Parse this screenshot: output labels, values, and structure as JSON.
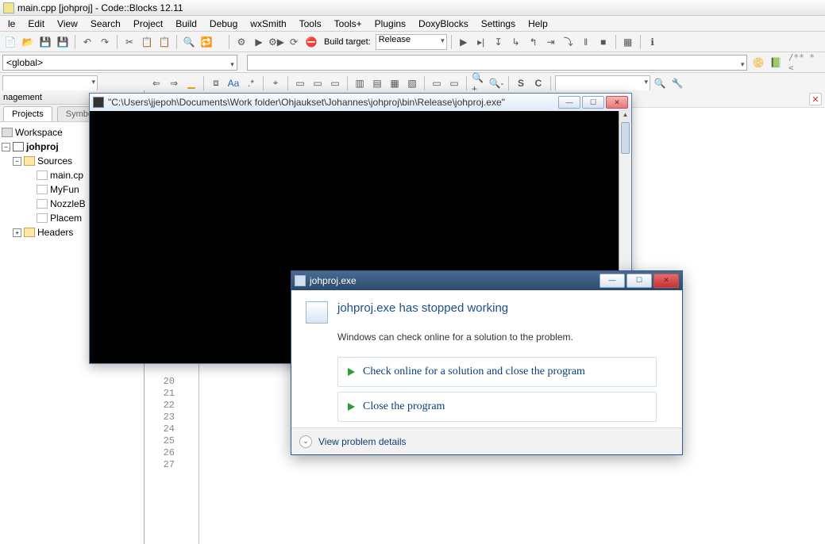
{
  "window_title": "main.cpp [johproj] - Code::Blocks 12.11",
  "menus": [
    "le",
    "Edit",
    "View",
    "Search",
    "Project",
    "Build",
    "Debug",
    "wxSmith",
    "Tools",
    "Tools+",
    "Plugins",
    "DoxyBlocks",
    "Settings",
    "Help"
  ],
  "build_target_label": "Build target:",
  "build_target_value": "Release",
  "global_scope": "<global>",
  "management_label": "nagement",
  "tabs": {
    "projects": "Projects",
    "symbols": "Symbol"
  },
  "tree": {
    "workspace": "Workspace",
    "project": "johproj",
    "sources": "Sources",
    "files": [
      "main.cp",
      "MyFun",
      "NozzleB",
      "Placem"
    ],
    "headers": "Headers"
  },
  "line_numbers": [
    "20",
    "21",
    "22",
    "23",
    "24",
    "25",
    "26",
    "27"
  ],
  "console_title": "\"C:\\Users\\jjepoh\\Documents\\Work folder\\Ohjaukset\\Johannes\\johproj\\bin\\Release\\johproj.exe\"",
  "error_dialog": {
    "caption": "johproj.exe",
    "headline": "johproj.exe has stopped working",
    "subtext": "Windows can check online for a solution to the problem.",
    "option1": "Check online for a solution and close the program",
    "option2": "Close the program",
    "details": "View problem details"
  }
}
